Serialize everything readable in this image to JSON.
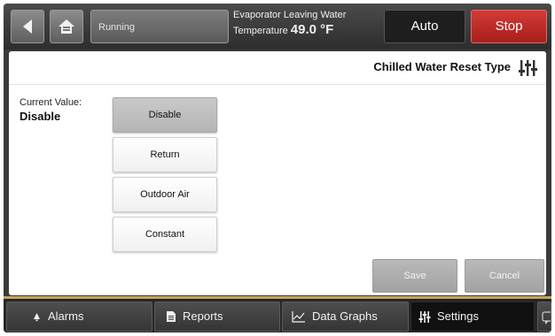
{
  "topbar": {
    "status": "Running",
    "readout_line1": "Evaporator Leaving Water",
    "readout_label": "Temperature",
    "readout_value": "49.0 °F",
    "auto_label": "Auto",
    "stop_label": "Stop"
  },
  "panel": {
    "title": "Chilled Water Reset Type",
    "current_label": "Current Value:",
    "current_value": "Disable",
    "options": [
      {
        "label": "Disable",
        "selected": true
      },
      {
        "label": "Return",
        "selected": false
      },
      {
        "label": "Outdoor Air",
        "selected": false
      },
      {
        "label": "Constant",
        "selected": false
      }
    ],
    "save_label": "Save",
    "cancel_label": "Cancel"
  },
  "tabs": [
    {
      "label": "Alarms",
      "icon": "bell-icon",
      "active": false
    },
    {
      "label": "Reports",
      "icon": "document-icon",
      "active": false
    },
    {
      "label": "Data Graphs",
      "icon": "line-graph-icon",
      "active": false
    },
    {
      "label": "Settings",
      "icon": "sliders-icon",
      "active": true
    }
  ],
  "colors": {
    "stop": "#c0302c",
    "accent_line": "#c6a55a",
    "selected_option": "#c1c1c1"
  }
}
